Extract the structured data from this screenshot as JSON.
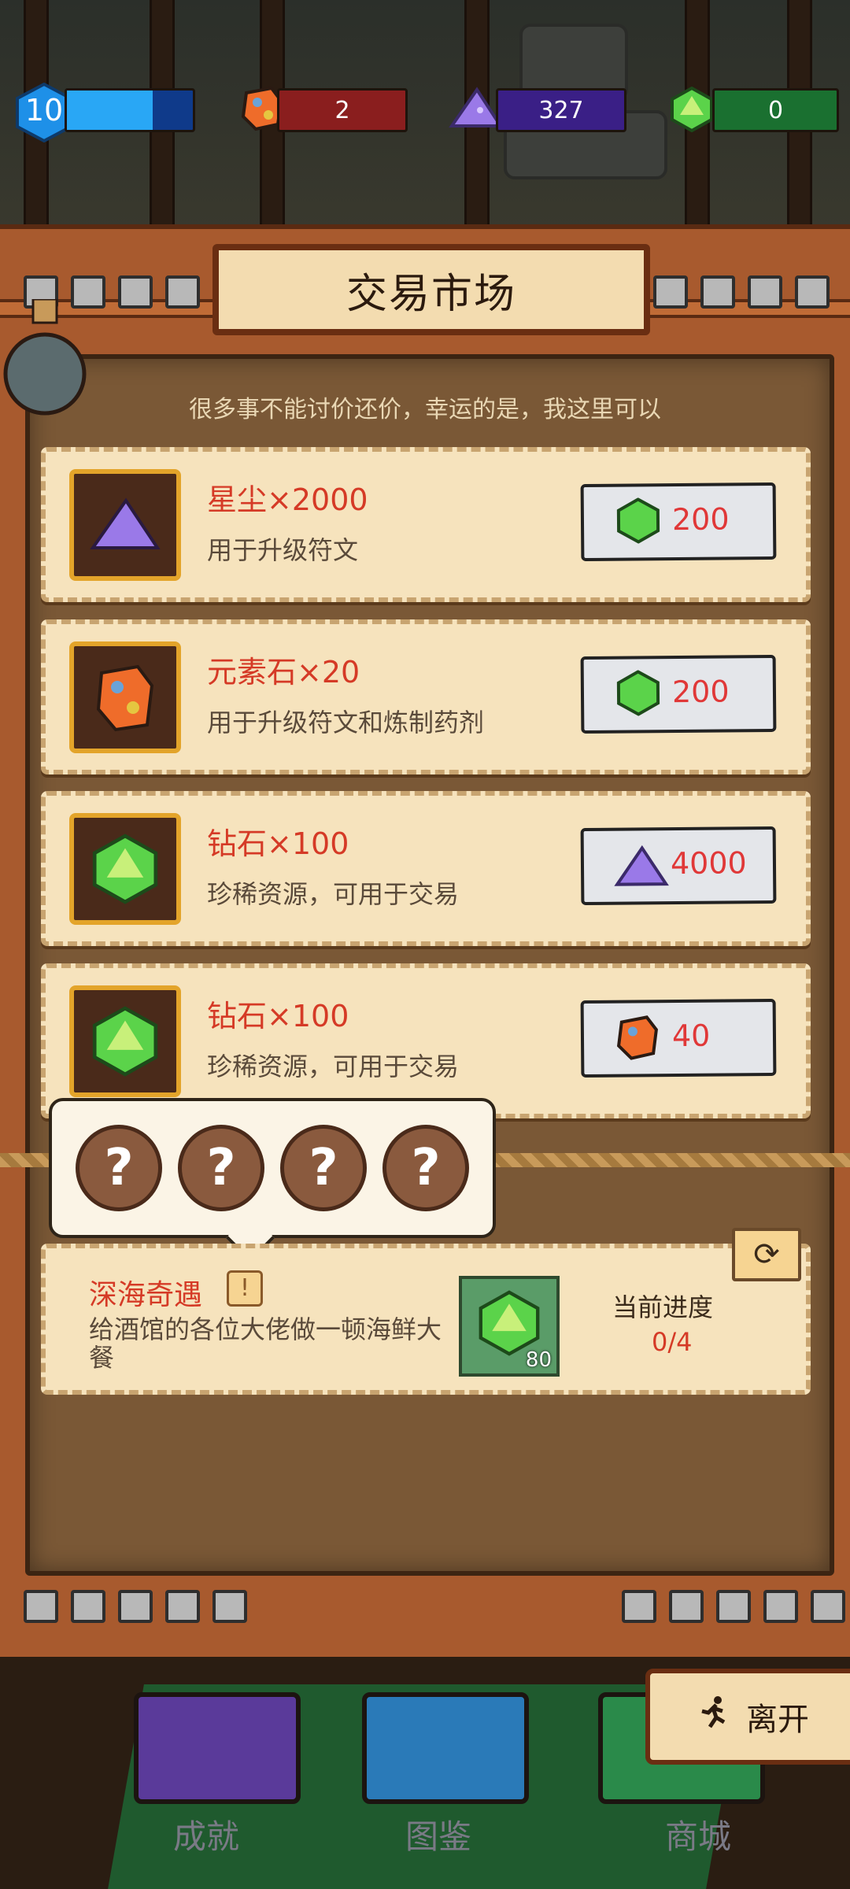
{
  "hud": {
    "level": "10",
    "level_progress": 0.68,
    "element_stone": "2",
    "stardust": "327",
    "diamond": "0"
  },
  "panel": {
    "title": "交易市场",
    "subtitle": "很多事不能讨价还价，幸运的是，我这里可以"
  },
  "trades": [
    {
      "name": "星尘×2000",
      "desc": "用于升级符文",
      "item_icon": "stardust-icon",
      "price": "200",
      "price_icon": "diamond-icon"
    },
    {
      "name": "元素石×20",
      "desc": "用于升级符文和炼制药剂",
      "item_icon": "element-stone-icon",
      "price": "200",
      "price_icon": "diamond-icon"
    },
    {
      "name": "钻石×100",
      "desc": "珍稀资源，可用于交易",
      "item_icon": "diamond-icon",
      "price": "4000",
      "price_icon": "stardust-icon"
    },
    {
      "name": "钻石×100",
      "desc": "珍稀资源，可用于交易",
      "item_icon": "diamond-icon",
      "price": "40",
      "price_icon": "element-stone-icon"
    }
  ],
  "mystery": [
    "?",
    "?",
    "?",
    "?"
  ],
  "quest": {
    "title": "深海奇遇",
    "warn": "!",
    "desc": "给酒馆的各位大佬做一顿海鲜大餐",
    "reward_count": "80",
    "progress_label": "当前进度",
    "progress_value": "0/4"
  },
  "nav": {
    "achievements": "成就",
    "codex": "图鉴",
    "shop": "商城",
    "leave": "离开"
  },
  "colors": {
    "accent_red": "#d53a26",
    "panel_brown": "#a85a2e",
    "card_bg": "#f6e3bd"
  }
}
